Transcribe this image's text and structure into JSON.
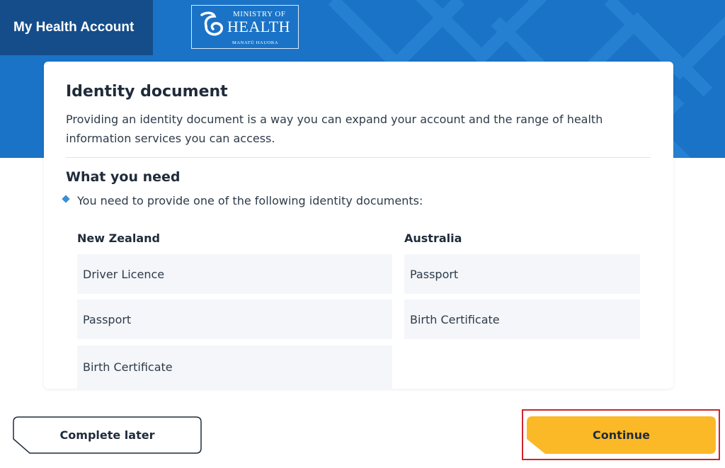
{
  "header": {
    "app_title": "My Health Account",
    "logo": {
      "line1": "MINISTRY OF",
      "line2": "HEALTH",
      "line3": "MANATŪ HAUORA"
    }
  },
  "card": {
    "title": "Identity document",
    "intro": "Providing an identity document is a way you can expand your account and the range of health information services you can access.",
    "need_title": "What you need",
    "bullet": "You need to provide one of the following identity documents:",
    "columns": [
      {
        "title": "New Zealand",
        "items": [
          "Driver Licence",
          "Passport",
          "Birth Certificate"
        ]
      },
      {
        "title": "Australia",
        "items": [
          "Passport",
          "Birth Certificate"
        ]
      }
    ]
  },
  "footer": {
    "complete_later_label": "Complete later",
    "continue_label": "Continue"
  },
  "colors": {
    "hero_blue": "#1a73c6",
    "header_dark_blue": "#154d8a",
    "continue_yellow": "#fbb928",
    "highlight_red": "#d0242b",
    "bullet_blue": "#3a8fd6"
  }
}
